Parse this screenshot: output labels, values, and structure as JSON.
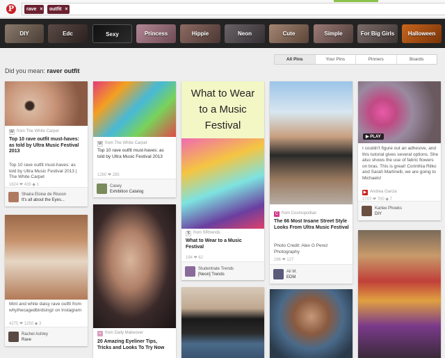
{
  "search": {
    "tokens": [
      "rave",
      "outfit"
    ]
  },
  "categories": [
    "DIY",
    "Edc",
    "Sexy",
    "Princess",
    "Hippie",
    "Neon",
    "Cute",
    "Simple",
    "For Big Girls",
    "Halloween"
  ],
  "filters": [
    "All Pins",
    "Your Pins",
    "Pinners",
    "Boards"
  ],
  "didyoumean": {
    "prefix": "Did you mean:",
    "suggestion": "raver outfit"
  },
  "pins": [
    {
      "src": "from The White Carpet",
      "title": "Top 10 rave outfit must-haves: as told by Ultra Music Festival 2013",
      "desc": "Top 10 rave outfit must-haves: as told by Ultra Music Festival 2013 | The White Carpet",
      "stats": "1624 ❤ 439 ◆ 1",
      "user": "Shaira Eloise de Risoon",
      "board": "It's all about the Eyes..."
    },
    {
      "src": "from The White Carpet",
      "title": "",
      "desc": "Top 10 rave outfit must-haves: as told by Ultra Music Festival 2013",
      "stats": "1260 ❤ 285",
      "user": "Casey",
      "board": "Exhibition Catalog"
    },
    {
      "poster": "What to Wear to a Music Festival",
      "src": "from SRtrends",
      "title": "What to Wear to a Music Festival",
      "stats": "194 ❤ 62",
      "user": "Studentrate Trends",
      "board": "[Neon] Trends"
    },
    {
      "src": "from Cosmopolitan",
      "title": "The 66 Most Insane Street Style Looks From Ultra Music Festival",
      "desc": "Photo Credit: Alex G Perez Photography",
      "stats": "296 ❤ 127",
      "user": "Ali M.",
      "board": "EDM"
    },
    {
      "play": "▶ PLAY",
      "desc": "I couldn't figure out an adhesive, and this tutorial gives several options. She also shows the use of fabric flowers on bras. This is great! Corinthia Rilko and Sarah Martinelli, we are going to Michaels!",
      "src": "from YouTube",
      "user": "Andrea Garcia",
      "stats": "2707 ❤ 700 ◆ 7",
      "user2": "Karlee Phoeks",
      "board": "DIY"
    },
    {
      "desc": "Mint and white daisy rave outfit from whythecagedbirdsingz on Instagram",
      "stats": "4275 ❤ 1250 ◆ 3",
      "user": "Rachel Ashley",
      "board": "Rave"
    },
    {
      "src": "from Daily Makeover",
      "title": "20 Amazing Eyeliner Tips, Tricks and Looks To Try Now"
    }
  ],
  "colors": {
    "accent": "#cb2027",
    "token": "#6b2231"
  }
}
